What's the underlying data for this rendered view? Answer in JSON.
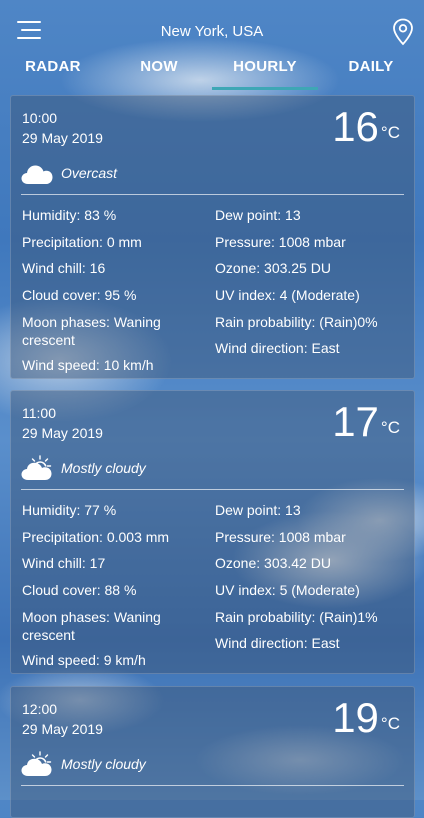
{
  "header": {
    "location": "New York, USA",
    "menu_icon": "hamburger-menu-icon",
    "location_icon": "map-pin-icon"
  },
  "tabs": [
    {
      "label": "RADAR",
      "active": false
    },
    {
      "label": "NOW",
      "active": false
    },
    {
      "label": "HOURLY",
      "active": true
    },
    {
      "label": "DAILY",
      "active": false
    }
  ],
  "colors": {
    "accent": "#3ea7b5"
  },
  "hourly": [
    {
      "time": "10:00",
      "date": "29 May 2019",
      "temp": "16",
      "unit": "°C",
      "condition": "Overcast",
      "icon": "cloud-icon",
      "left": [
        "Humidity: 83 %",
        "Precipitation: 0 mm",
        "Wind chill: 16",
        "Cloud cover: 95 %",
        "Moon phases: Waning crescent",
        "Wind speed: 10 km/h"
      ],
      "right": [
        "Dew point: 13",
        "Pressure: 1008 mbar",
        "Ozone: 303.25 DU",
        "UV index: 4 (Moderate)",
        "Rain probability: (Rain)0%",
        "Wind direction: East"
      ]
    },
    {
      "time": "11:00",
      "date": "29 May 2019",
      "temp": "17",
      "unit": "°C",
      "condition": "Mostly cloudy",
      "icon": "sun-behind-cloud-icon",
      "left": [
        "Humidity: 77 %",
        "Precipitation: 0.003 mm",
        "Wind chill: 17",
        "Cloud cover: 88 %",
        "Moon phases: Waning crescent",
        "Wind speed: 9 km/h"
      ],
      "right": [
        "Dew point: 13",
        "Pressure: 1008 mbar",
        "Ozone: 303.42 DU",
        "UV index: 5 (Moderate)",
        "Rain probability: (Rain)1%",
        "Wind direction: East"
      ]
    },
    {
      "time": "12:00",
      "date": "29 May 2019",
      "temp": "19",
      "unit": "°C",
      "condition": "Mostly cloudy",
      "icon": "sun-behind-cloud-icon"
    }
  ]
}
